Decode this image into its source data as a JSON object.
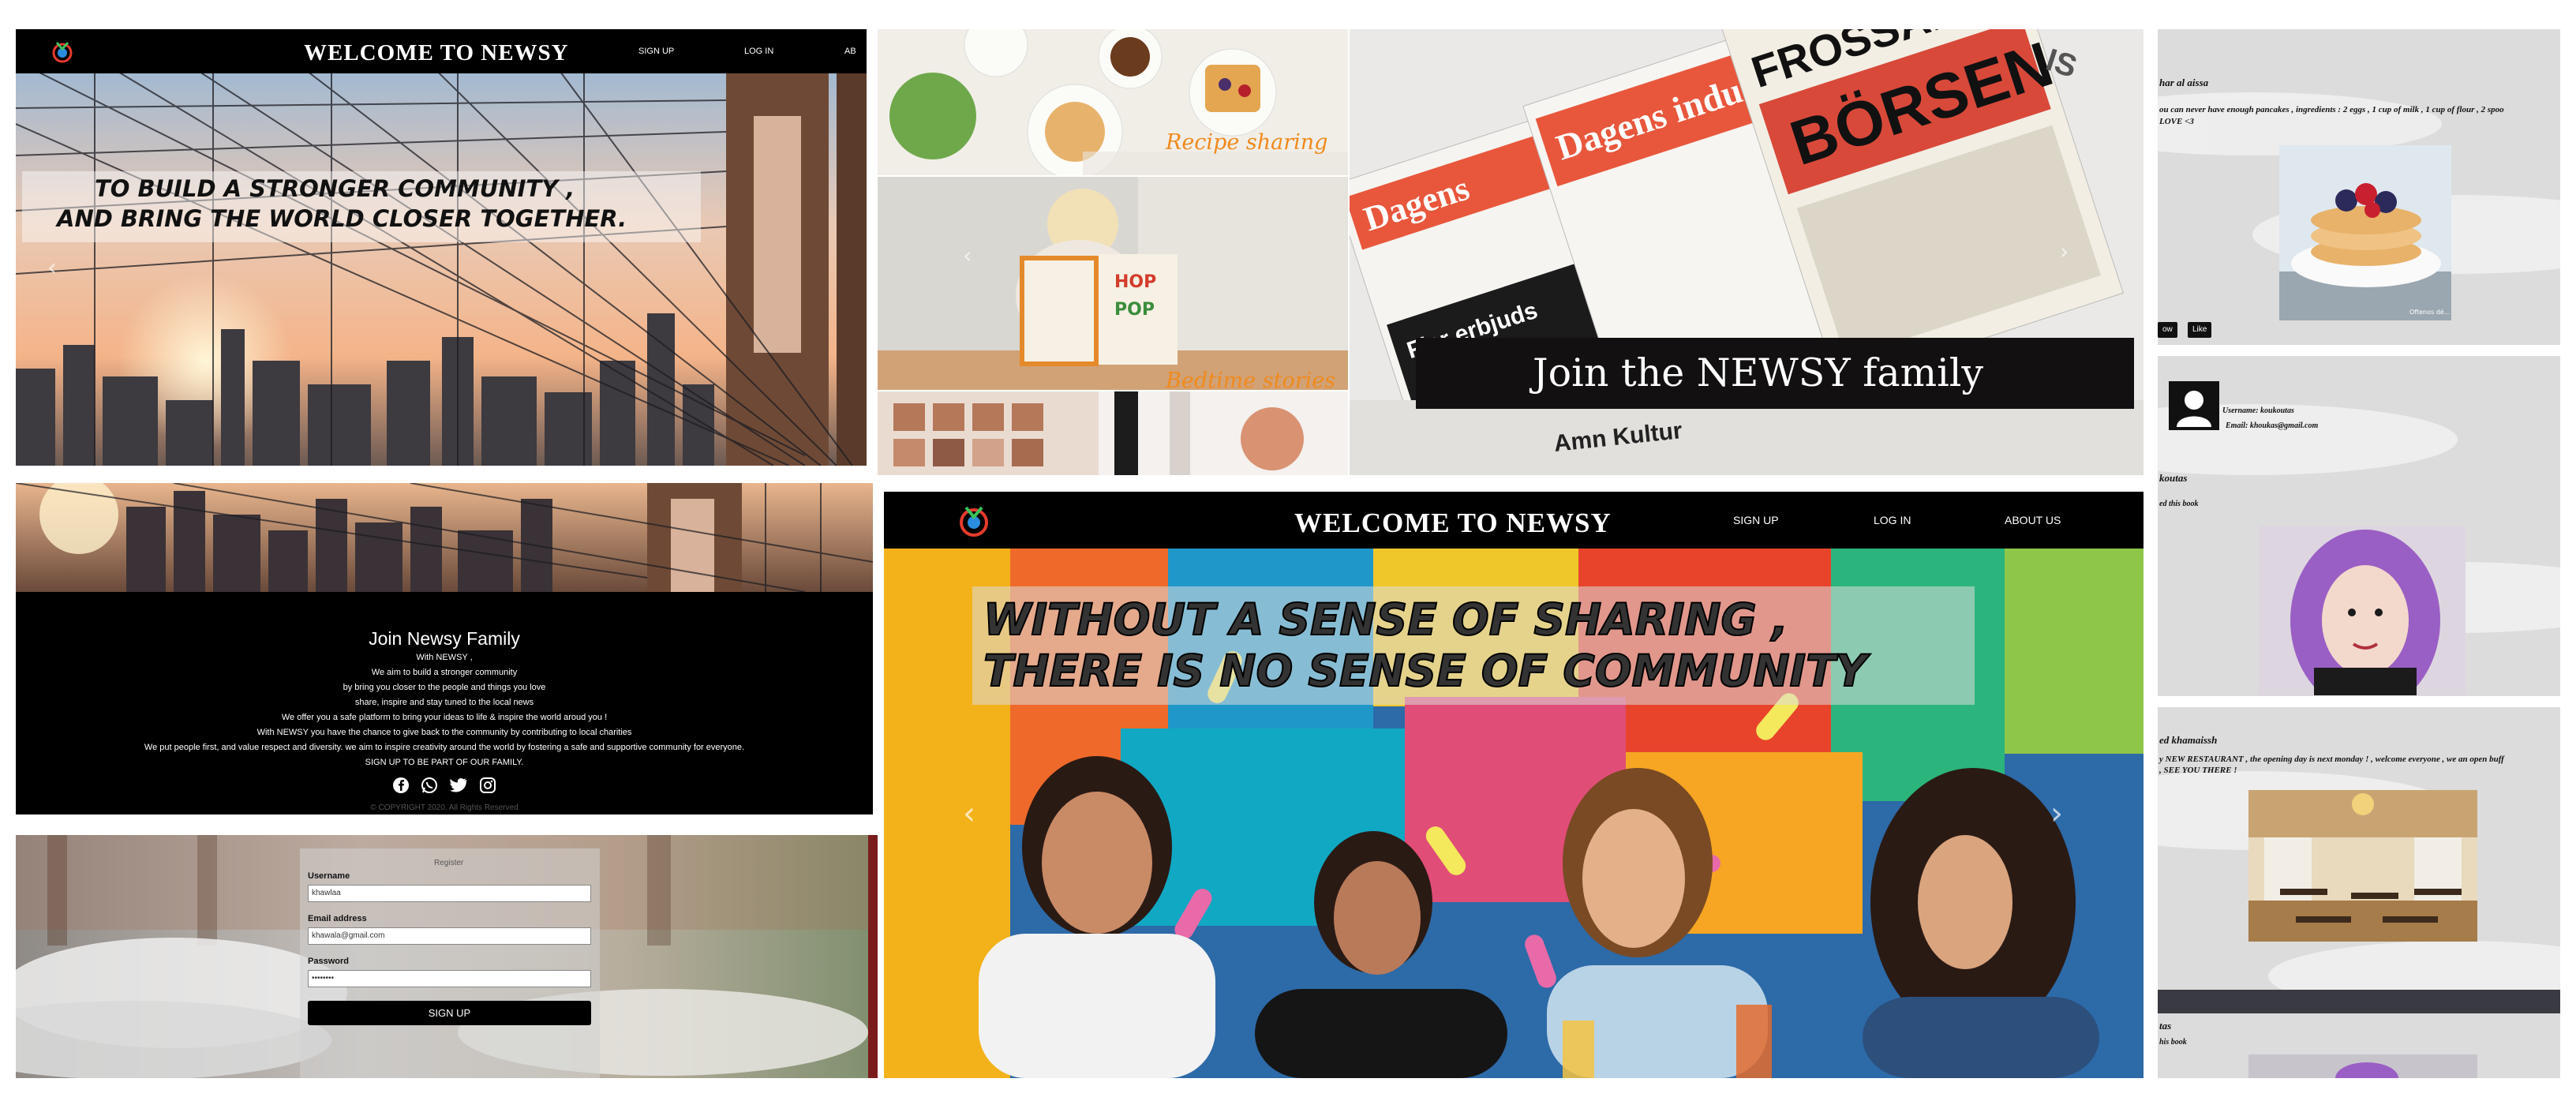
{
  "site": {
    "brand": "WELCOME TO NEWSY",
    "nav_signup": "SIGN UP",
    "nav_login": "LOG IN",
    "nav_about": "ABOUT US",
    "nav_about_cut": "AB"
  },
  "hero_top": {
    "line1": "TO BUILD A STRONGER COMMUNITY ,",
    "line2": "AND BRING THE WORLD CLOSER TOGETHER."
  },
  "hero_big": {
    "line1": "WITHOUT A SENSE OF SHARING ,",
    "line2": "THERE IS NO SENSE OF COMMUNITY"
  },
  "carousel": {
    "prev": "‹",
    "next": "›"
  },
  "collage": {
    "caption1": "Recipe sharing",
    "caption2": "Bedtime stories"
  },
  "join_banner": {
    "title": "Join the NEWSY family",
    "paper_words": [
      "Dagens",
      "Dagens industri",
      "FROSSAN PÅ BÖRSEN",
      "Fler erbjuds behandling – men få vill ha hjälp",
      "Amn Kultur",
      "IS"
    ]
  },
  "about": {
    "title": "Join Newsy Family",
    "lines": [
      "With NEWSY ,",
      "We aim to build a stronger community",
      "by bring you closer to the people and things you love",
      "share, inspire and stay tuned to the local news",
      "We offer you a safe platform to bring your ideas to life & inspire the world aroud you !",
      "With NEWSY you have the chance to give back to the community by contributing to local charities",
      "We put people first, and value respect and diversity. we aim to inspire creativity around the world by fostering a safe and supportive community for everyone.",
      "SIGN UP TO BE PART OF OUR FAMILY."
    ],
    "copyright": "© COPYRIGHT 2020. All Rights Reserved"
  },
  "social": [
    "facebook-icon",
    "whatsapp-icon",
    "twitter-icon",
    "instagram-icon"
  ],
  "signup_form": {
    "heading": "Register",
    "username_label": "Username",
    "username_value": "khawlaa",
    "email_label": "Email address",
    "email_value": "khawala@gmail.com",
    "password_label": "Password",
    "password_value": "••••••••",
    "submit": "SIGN UP"
  },
  "feed": {
    "post1": {
      "author": "har al aissa",
      "text": "ou can never have enough pancakes , ingredients : 2 eggs , 1 cup of milk , 1 cup of flour , 2 spoo",
      "text2": "LOVE <3",
      "btn_left": "ow",
      "btn_like": "Like",
      "img_caption": "Oftenos dé..."
    },
    "profile": {
      "username": "Username: koukoutas",
      "email": "Email: khoukas@gmail.com",
      "name": "koutas",
      "liked": "ed this book"
    },
    "post2": {
      "author": "ed khamaissh",
      "text": "y NEW RESTAURANT , the opening day is next monday ! , welcome everyone , we an open buff",
      "text2": ", SEE YOU THERE !"
    },
    "post3": {
      "author": "tas",
      "text": "his book"
    }
  },
  "colors": {
    "nav_bg": "#000000",
    "accent_orange": "#f08a1c",
    "banner_dark": "#121010"
  }
}
